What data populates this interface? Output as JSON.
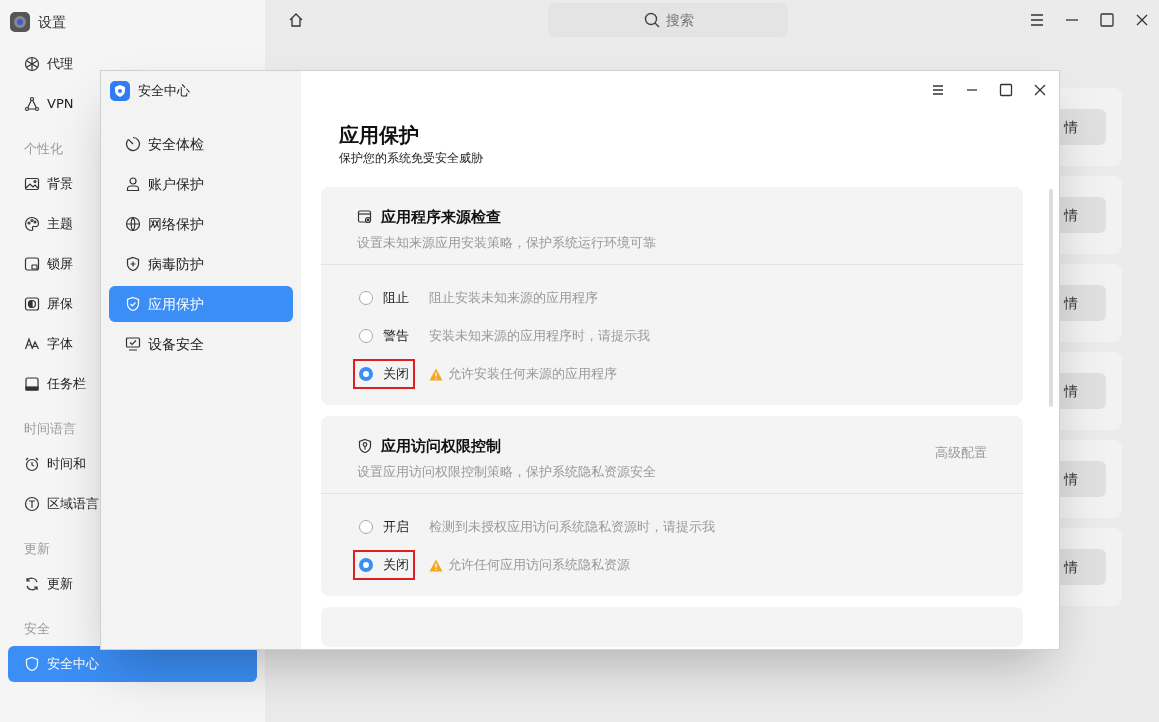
{
  "settings": {
    "title": "设置",
    "search": {
      "placeholder": "搜索"
    },
    "sidebar": [
      {
        "kind": "item",
        "label": "代理",
        "selected": false
      },
      {
        "kind": "item",
        "label": "VPN",
        "selected": false
      },
      {
        "kind": "header",
        "label": "个性化"
      },
      {
        "kind": "item",
        "label": "背景",
        "selected": false
      },
      {
        "kind": "item",
        "label": "主题",
        "selected": false
      },
      {
        "kind": "item",
        "label": "锁屏",
        "selected": false
      },
      {
        "kind": "item",
        "label": "屏保",
        "selected": false
      },
      {
        "kind": "item",
        "label": "字体",
        "selected": false
      },
      {
        "kind": "item",
        "label": "任务栏",
        "selected": false
      },
      {
        "kind": "header",
        "label": "时间语言"
      },
      {
        "kind": "item",
        "label": "时间和",
        "selected": false
      },
      {
        "kind": "item",
        "label": "区域语言",
        "selected": false
      },
      {
        "kind": "header",
        "label": "更新"
      },
      {
        "kind": "item",
        "label": "更新",
        "selected": false
      },
      {
        "kind": "header",
        "label": "安全"
      },
      {
        "kind": "item",
        "label": "安全中心",
        "selected": true
      }
    ],
    "cards": [
      {
        "button": "情"
      },
      {
        "button": "情"
      },
      {
        "button": "情"
      },
      {
        "button": "情"
      },
      {
        "button": "情"
      },
      {
        "button": "情"
      }
    ]
  },
  "security_center": {
    "title": "安全中心",
    "nav": [
      {
        "label": "安全体检",
        "selected": false
      },
      {
        "label": "账户保护",
        "selected": false
      },
      {
        "label": "网络保护",
        "selected": false
      },
      {
        "label": "病毒防护",
        "selected": false
      },
      {
        "label": "应用保护",
        "selected": true
      },
      {
        "label": "设备安全",
        "selected": false
      }
    ],
    "heading": "应用保护",
    "subheading": "保护您的系统免受安全威胁",
    "sections": [
      {
        "title": "应用程序来源检查",
        "description": "设置未知来源应用安装策略，保护系统运行环境可靠",
        "options": [
          {
            "label": "阻止",
            "note": "阻止安装未知来源的应用程序",
            "selected": false,
            "warning": false,
            "highlighted": false
          },
          {
            "label": "警告",
            "note": "安装未知来源的应用程序时，请提示我",
            "selected": false,
            "warning": false,
            "highlighted": false
          },
          {
            "label": "关闭",
            "note": "允许安装任何来源的应用程序",
            "selected": true,
            "warning": true,
            "highlighted": true
          }
        ]
      },
      {
        "title": "应用访问权限控制",
        "description": "设置应用访问权限控制策略，保护系统隐私资源安全",
        "link": "高级配置",
        "options": [
          {
            "label": "开启",
            "note": "检测到未授权应用访问系统隐私资源时，请提示我",
            "selected": false,
            "warning": false,
            "highlighted": false
          },
          {
            "label": "关闭",
            "note": "允许任何应用访问系统隐私资源",
            "selected": true,
            "warning": true,
            "highlighted": true
          }
        ]
      }
    ]
  }
}
